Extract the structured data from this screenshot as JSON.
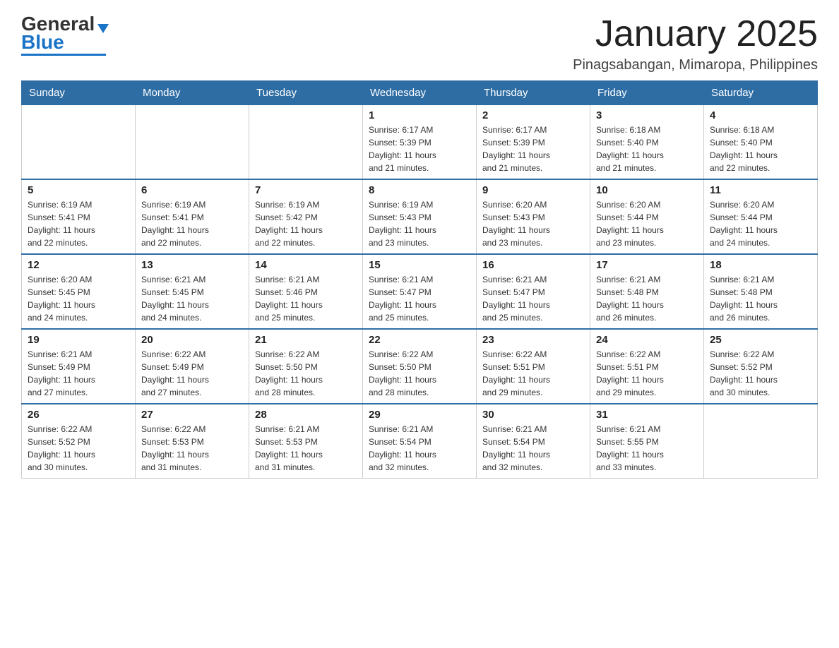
{
  "header": {
    "logo": {
      "text_general": "General",
      "text_blue": "Blue",
      "triangle_indicator": "▲"
    },
    "title": "January 2025",
    "subtitle": "Pinagsabangan, Mimaropa, Philippines"
  },
  "calendar": {
    "days_of_week": [
      "Sunday",
      "Monday",
      "Tuesday",
      "Wednesday",
      "Thursday",
      "Friday",
      "Saturday"
    ],
    "weeks": [
      [
        {
          "day": "",
          "info": ""
        },
        {
          "day": "",
          "info": ""
        },
        {
          "day": "",
          "info": ""
        },
        {
          "day": "1",
          "info": "Sunrise: 6:17 AM\nSunset: 5:39 PM\nDaylight: 11 hours\nand 21 minutes."
        },
        {
          "day": "2",
          "info": "Sunrise: 6:17 AM\nSunset: 5:39 PM\nDaylight: 11 hours\nand 21 minutes."
        },
        {
          "day": "3",
          "info": "Sunrise: 6:18 AM\nSunset: 5:40 PM\nDaylight: 11 hours\nand 21 minutes."
        },
        {
          "day": "4",
          "info": "Sunrise: 6:18 AM\nSunset: 5:40 PM\nDaylight: 11 hours\nand 22 minutes."
        }
      ],
      [
        {
          "day": "5",
          "info": "Sunrise: 6:19 AM\nSunset: 5:41 PM\nDaylight: 11 hours\nand 22 minutes."
        },
        {
          "day": "6",
          "info": "Sunrise: 6:19 AM\nSunset: 5:41 PM\nDaylight: 11 hours\nand 22 minutes."
        },
        {
          "day": "7",
          "info": "Sunrise: 6:19 AM\nSunset: 5:42 PM\nDaylight: 11 hours\nand 22 minutes."
        },
        {
          "day": "8",
          "info": "Sunrise: 6:19 AM\nSunset: 5:43 PM\nDaylight: 11 hours\nand 23 minutes."
        },
        {
          "day": "9",
          "info": "Sunrise: 6:20 AM\nSunset: 5:43 PM\nDaylight: 11 hours\nand 23 minutes."
        },
        {
          "day": "10",
          "info": "Sunrise: 6:20 AM\nSunset: 5:44 PM\nDaylight: 11 hours\nand 23 minutes."
        },
        {
          "day": "11",
          "info": "Sunrise: 6:20 AM\nSunset: 5:44 PM\nDaylight: 11 hours\nand 24 minutes."
        }
      ],
      [
        {
          "day": "12",
          "info": "Sunrise: 6:20 AM\nSunset: 5:45 PM\nDaylight: 11 hours\nand 24 minutes."
        },
        {
          "day": "13",
          "info": "Sunrise: 6:21 AM\nSunset: 5:45 PM\nDaylight: 11 hours\nand 24 minutes."
        },
        {
          "day": "14",
          "info": "Sunrise: 6:21 AM\nSunset: 5:46 PM\nDaylight: 11 hours\nand 25 minutes."
        },
        {
          "day": "15",
          "info": "Sunrise: 6:21 AM\nSunset: 5:47 PM\nDaylight: 11 hours\nand 25 minutes."
        },
        {
          "day": "16",
          "info": "Sunrise: 6:21 AM\nSunset: 5:47 PM\nDaylight: 11 hours\nand 25 minutes."
        },
        {
          "day": "17",
          "info": "Sunrise: 6:21 AM\nSunset: 5:48 PM\nDaylight: 11 hours\nand 26 minutes."
        },
        {
          "day": "18",
          "info": "Sunrise: 6:21 AM\nSunset: 5:48 PM\nDaylight: 11 hours\nand 26 minutes."
        }
      ],
      [
        {
          "day": "19",
          "info": "Sunrise: 6:21 AM\nSunset: 5:49 PM\nDaylight: 11 hours\nand 27 minutes."
        },
        {
          "day": "20",
          "info": "Sunrise: 6:22 AM\nSunset: 5:49 PM\nDaylight: 11 hours\nand 27 minutes."
        },
        {
          "day": "21",
          "info": "Sunrise: 6:22 AM\nSunset: 5:50 PM\nDaylight: 11 hours\nand 28 minutes."
        },
        {
          "day": "22",
          "info": "Sunrise: 6:22 AM\nSunset: 5:50 PM\nDaylight: 11 hours\nand 28 minutes."
        },
        {
          "day": "23",
          "info": "Sunrise: 6:22 AM\nSunset: 5:51 PM\nDaylight: 11 hours\nand 29 minutes."
        },
        {
          "day": "24",
          "info": "Sunrise: 6:22 AM\nSunset: 5:51 PM\nDaylight: 11 hours\nand 29 minutes."
        },
        {
          "day": "25",
          "info": "Sunrise: 6:22 AM\nSunset: 5:52 PM\nDaylight: 11 hours\nand 30 minutes."
        }
      ],
      [
        {
          "day": "26",
          "info": "Sunrise: 6:22 AM\nSunset: 5:52 PM\nDaylight: 11 hours\nand 30 minutes."
        },
        {
          "day": "27",
          "info": "Sunrise: 6:22 AM\nSunset: 5:53 PM\nDaylight: 11 hours\nand 31 minutes."
        },
        {
          "day": "28",
          "info": "Sunrise: 6:21 AM\nSunset: 5:53 PM\nDaylight: 11 hours\nand 31 minutes."
        },
        {
          "day": "29",
          "info": "Sunrise: 6:21 AM\nSunset: 5:54 PM\nDaylight: 11 hours\nand 32 minutes."
        },
        {
          "day": "30",
          "info": "Sunrise: 6:21 AM\nSunset: 5:54 PM\nDaylight: 11 hours\nand 32 minutes."
        },
        {
          "day": "31",
          "info": "Sunrise: 6:21 AM\nSunset: 5:55 PM\nDaylight: 11 hours\nand 33 minutes."
        },
        {
          "day": "",
          "info": ""
        }
      ]
    ]
  }
}
